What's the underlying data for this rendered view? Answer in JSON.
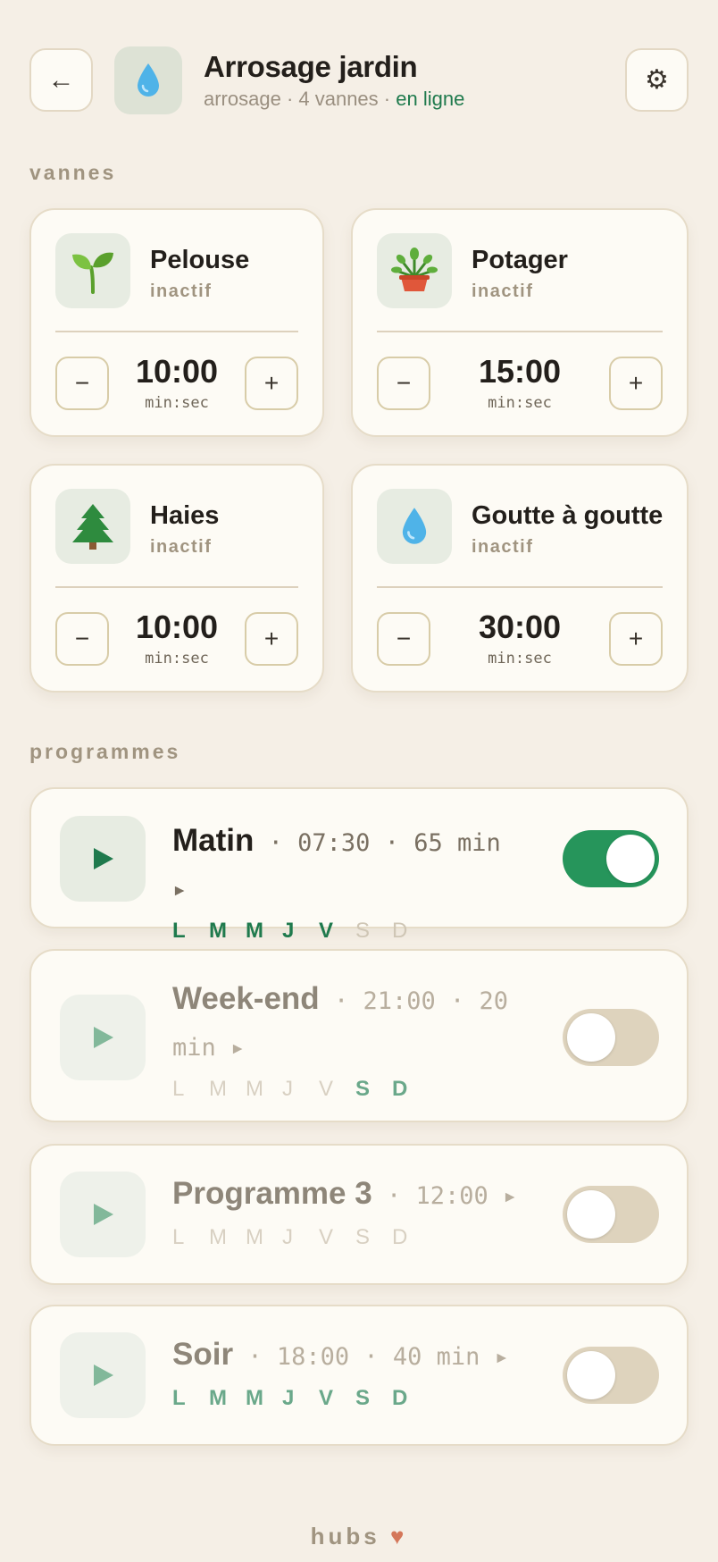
{
  "header": {
    "back_icon": "←",
    "title": "Arrosage jardin",
    "subtitle_prefix": "arrosage · 4 vannes · ",
    "status": "en ligne",
    "settings_icon": "⚙",
    "app_icon": "water-drop"
  },
  "sections": {
    "valves": "vannes",
    "programs": "programmes"
  },
  "valves": [
    {
      "name": "Pelouse",
      "status": "inactif",
      "icon": "seedling",
      "time": "10:00",
      "unit": "min:sec",
      "minus": "−",
      "plus": "+"
    },
    {
      "name": "Potager",
      "status": "inactif",
      "icon": "potted-plant",
      "time": "15:00",
      "unit": "min:sec",
      "minus": "−",
      "plus": "+"
    },
    {
      "name": "Haies",
      "status": "inactif",
      "icon": "evergreen-tree",
      "time": "10:00",
      "unit": "min:sec",
      "minus": "−",
      "plus": "+"
    },
    {
      "name": "Goutte à goutte",
      "status": "inactif",
      "icon": "water-drop",
      "time": "30:00",
      "unit": "min:sec",
      "minus": "−",
      "plus": "+"
    }
  ],
  "programs": [
    {
      "name": "Matin",
      "meta": " · 07:30 · 65 min ▸",
      "enabled": true,
      "days": [
        "L",
        "M",
        "M",
        "J",
        "V",
        "S",
        "D"
      ],
      "active_days": [
        true,
        true,
        true,
        true,
        true,
        false,
        false
      ]
    },
    {
      "name": "Week-end",
      "meta": " · 21:00 · 20 min ▸",
      "enabled": false,
      "days": [
        "L",
        "M",
        "M",
        "J",
        "V",
        "S",
        "D"
      ],
      "active_days": [
        false,
        false,
        false,
        false,
        false,
        true,
        true
      ]
    },
    {
      "name": "Programme 3",
      "meta": " · 12:00 ▸",
      "enabled": false,
      "days": [
        "L",
        "M",
        "M",
        "J",
        "V",
        "S",
        "D"
      ],
      "active_days": [
        false,
        false,
        false,
        false,
        false,
        false,
        false
      ]
    },
    {
      "name": "Soir",
      "meta": " · 18:00 · 40 min ▸",
      "enabled": false,
      "days": [
        "L",
        "M",
        "M",
        "J",
        "V",
        "S",
        "D"
      ],
      "active_days": [
        true,
        true,
        true,
        true,
        true,
        true,
        true
      ]
    }
  ],
  "footer": {
    "brand": "hubs",
    "heart": "♥"
  },
  "colors": {
    "background": "#f5efe6",
    "accent_green": "#26955b",
    "online_green": "#1f7a4d",
    "toggle_off": "#ded3bd",
    "heart": "#d4775a"
  }
}
